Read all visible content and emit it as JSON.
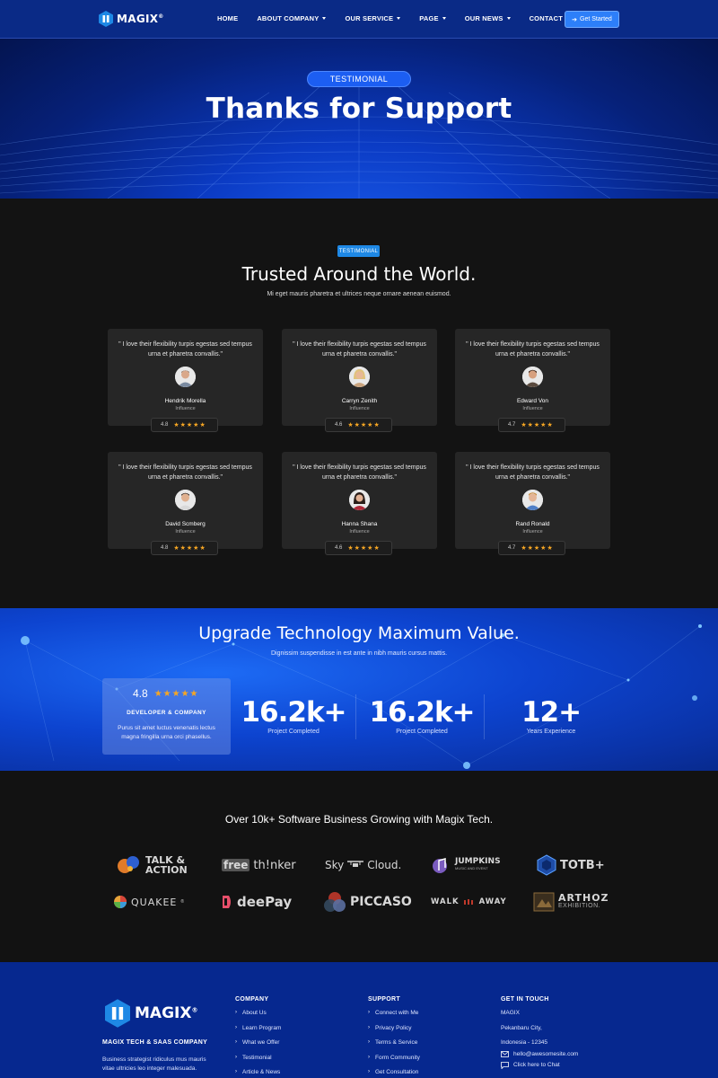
{
  "header": {
    "logo_text": "MAGIX",
    "logo_mark": "®",
    "nav": [
      {
        "label": "HOME",
        "dropdown": false
      },
      {
        "label": "ABOUT COMPANY",
        "dropdown": true
      },
      {
        "label": "OUR SERVICE",
        "dropdown": true
      },
      {
        "label": "PAGE",
        "dropdown": true
      },
      {
        "label": "OUR NEWS",
        "dropdown": true
      },
      {
        "label": "CONTACT US",
        "dropdown": false
      }
    ],
    "cta_label": "Get Started"
  },
  "hero": {
    "badge": "TESTIMONIAL",
    "title": "Thanks for Support"
  },
  "testimonials": {
    "tag": "TESTIMONIAL",
    "title": "Trusted Around the World.",
    "subtitle": "Mi eget mauris pharetra et ultrices neque ornare aenean euismod.",
    "items": [
      {
        "quote": "\" I love their flexibility turpis egestas sed tempus urna et pharetra convallis.\"",
        "name": "Hendrik Morella",
        "role": "Influence",
        "rating": "4.8",
        "stars": "★★★★★"
      },
      {
        "quote": "\" I love their flexibility turpis egestas sed tempus urna et pharetra convallis.\"",
        "name": "Carryn Zenith",
        "role": "Influence",
        "rating": "4.6",
        "stars": "★★★★★"
      },
      {
        "quote": "\" I love their flexibility turpis egestas sed tempus urna et pharetra convallis.\"",
        "name": "Edward Von",
        "role": "Influence",
        "rating": "4.7",
        "stars": "★★★★★"
      },
      {
        "quote": "\" I love their flexibility turpis egestas sed tempus urna et pharetra convallis.\"",
        "name": "David Scmberg",
        "role": "Influence",
        "rating": "4.8",
        "stars": "★★★★★"
      },
      {
        "quote": "\" I love their flexibility turpis egestas sed tempus urna et pharetra convallis.\"",
        "name": "Hanna Shana",
        "role": "Influence",
        "rating": "4.6",
        "stars": "★★★★★"
      },
      {
        "quote": "\" I love their flexibility turpis egestas sed tempus urna et pharetra convallis.\"",
        "name": "Rand Ronald",
        "role": "Influence",
        "rating": "4.7",
        "stars": "★★★★★"
      }
    ]
  },
  "stats": {
    "title": "Upgrade Technology Maximum Value.",
    "subtitle": "Dignissim suspendisse in est ante in nibh mauris cursus mattis.",
    "card": {
      "rating": "4.8",
      "stars": "★★★★★",
      "title": "DEVELOPER & COMPANY",
      "desc": "Purus sit amet luctus venenatis lectus magna fringilla urna orci phasellus."
    },
    "items": [
      {
        "value": "16.2k+",
        "label": "Project Completed"
      },
      {
        "value": "16.2k+",
        "label": "Project Completed"
      },
      {
        "value": "12+",
        "label": "Years Experience"
      }
    ]
  },
  "clients": {
    "title": "Over 10k+ Software Business Growing with Magix Tech.",
    "brands": [
      {
        "name": "TALK & ACTION",
        "line1": "TALK &",
        "line2": "ACTION"
      },
      {
        "name": "free thinker",
        "free": "free",
        "rest": "th!nker"
      },
      {
        "name": "SkyCloud.",
        "sky": "Sky",
        "cloud": "Cloud."
      },
      {
        "name": "JUMPKINS",
        "sub": "MUSIC AND EVENT"
      },
      {
        "name": "TOTB+"
      },
      {
        "name": "QUAKEE",
        "mark": "®"
      },
      {
        "name": "deePay"
      },
      {
        "name": "PICCASO"
      },
      {
        "name": "WALK AWAY",
        "walk": "WALK",
        "away": "AWAY"
      },
      {
        "name": "ARTHOZ",
        "sub": "EXHIBITION."
      }
    ]
  },
  "footer": {
    "logo_text": "MAGIX",
    "logo_mark": "®",
    "company": "MAGIX TECH & SAAS COMPANY",
    "desc": "Business strategist ridiculus mus mauris vitae ultricies leo integer malesuada.",
    "col_company": {
      "title": "COMPANY",
      "links": [
        "About Us",
        "Learn Program",
        "What we Offer",
        "Testimonial",
        "Article & News"
      ]
    },
    "col_support": {
      "title": "SUPPORT",
      "links": [
        "Connect with Me",
        "Privacy Policy",
        "Terms & Service",
        "Form Community",
        "Get Consultation"
      ]
    },
    "col_contact": {
      "title": "GET IN TOUCH",
      "lines": [
        "MAGIX",
        "Pekanbaru City,",
        "Indonesia - 12345"
      ],
      "email": "hello@awesomesite.com",
      "chat": "Click here to Chat"
    }
  }
}
